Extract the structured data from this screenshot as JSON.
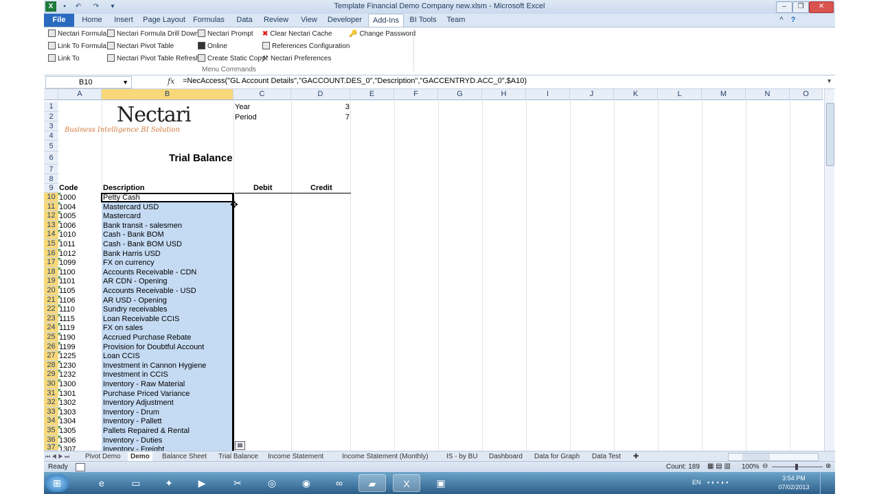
{
  "window": {
    "title": "Template Financial Demo Company new.xlsm  -  Microsoft Excel"
  },
  "ribbon_tabs": [
    "File",
    "Home",
    "Insert",
    "Page Layout",
    "Formulas",
    "Data",
    "Review",
    "View",
    "Developer",
    "Add-Ins",
    "BI Tools",
    "Team"
  ],
  "ribbon": {
    "buttons": [
      "Nectari Formula",
      "Nectari Formula Drill Down",
      "Nectari Prompt",
      "Clear Nectari Cache",
      "Change Password",
      "Link To Formula",
      "Nectari Pivot Table",
      "Online",
      "References Configuration",
      "Link To",
      "Nectari Pivot Table Refresh",
      "Create Static Copy",
      "Nectari Preferences"
    ],
    "group_label": "Menu Commands"
  },
  "formula_bar": {
    "name_box": "B10",
    "fx": "fx",
    "formula": "=NecAccess(\"GL Account Details\",\"GACCOUNT.DES_0\",\"Description\",\"GACCENTRYD.ACC_0\",$A10)"
  },
  "columns": [
    "A",
    "B",
    "C",
    "D",
    "E",
    "F",
    "G",
    "H",
    "I",
    "J",
    "K",
    "L",
    "M",
    "N",
    "O"
  ],
  "row_numbers": [
    "1",
    "2",
    "3",
    "4",
    "5",
    "6",
    "7",
    "8",
    "9",
    "10",
    "11",
    "12",
    "13",
    "14",
    "15",
    "16",
    "17",
    "18",
    "19",
    "20",
    "21",
    "22",
    "23",
    "24",
    "25",
    "26",
    "27",
    "28",
    "29",
    "30",
    "31",
    "32",
    "33",
    "34",
    "35",
    "36",
    "37"
  ],
  "logo": {
    "brand": "Nectari",
    "tagline": "Business Intelligence BI Solution"
  },
  "params": {
    "year_label": "Year",
    "year_value": "3",
    "period_label": "Period",
    "period_value": "7"
  },
  "report_title": "Trial Balance",
  "headers": {
    "code": "Code",
    "description": "Description",
    "debit": "Debit",
    "credit": "Credit"
  },
  "rows": [
    {
      "code": "1000",
      "desc": "Petty Cash"
    },
    {
      "code": "1004",
      "desc": "Mastercard USD"
    },
    {
      "code": "1005",
      "desc": "Mastercard"
    },
    {
      "code": "1006",
      "desc": "Bank transit - salesmen"
    },
    {
      "code": "1010",
      "desc": "Cash - Bank BOM"
    },
    {
      "code": "1011",
      "desc": "Cash - Bank BOM USD"
    },
    {
      "code": "1012",
      "desc": "Bank Harris USD"
    },
    {
      "code": "1099",
      "desc": "FX on currency"
    },
    {
      "code": "1100",
      "desc": "Accounts Receivable - CDN"
    },
    {
      "code": "1101",
      "desc": "AR CDN - Opening"
    },
    {
      "code": "1105",
      "desc": "Accounts Receivable - USD"
    },
    {
      "code": "1106",
      "desc": "AR USD - Opening"
    },
    {
      "code": "1110",
      "desc": "Sundry receivables"
    },
    {
      "code": "1115",
      "desc": "Loan Receivable CCIS"
    },
    {
      "code": "1119",
      "desc": "FX on sales"
    },
    {
      "code": "1190",
      "desc": "Accrued Purchase Rebate"
    },
    {
      "code": "1199",
      "desc": "Provision for Doubtful Account"
    },
    {
      "code": "1225",
      "desc": "Loan CCIS"
    },
    {
      "code": "1230",
      "desc": "Investment in Cannon Hygiene"
    },
    {
      "code": "1232",
      "desc": "Investment in CCIS"
    },
    {
      "code": "1300",
      "desc": "Inventory - Raw Material"
    },
    {
      "code": "1301",
      "desc": "Purchase Priced Variance"
    },
    {
      "code": "1302",
      "desc": "Inventory Adjustment"
    },
    {
      "code": "1303",
      "desc": "Inventory - Drum"
    },
    {
      "code": "1304",
      "desc": "Inventory - Pallett"
    },
    {
      "code": "1305",
      "desc": "Pallets Repaired & Rental"
    },
    {
      "code": "1306",
      "desc": "Inventory - Duties"
    },
    {
      "code": "1307",
      "desc": "Inventory - Freight"
    }
  ],
  "sheet_tabs": [
    "Pivot Demo",
    "Demo",
    "Balance Sheet",
    "Trial Balance",
    "Income Statement",
    "Income Statement (Monthly)",
    "IS - by BU",
    "Dashboard",
    "Data for Graph",
    "Data Test"
  ],
  "active_sheet": "Demo",
  "status": {
    "ready": "Ready",
    "count": "Count: 189",
    "zoom": "100%"
  },
  "taskbar": {
    "time": "3:54 PM",
    "date": "07/02/2013",
    "lang": "EN"
  }
}
